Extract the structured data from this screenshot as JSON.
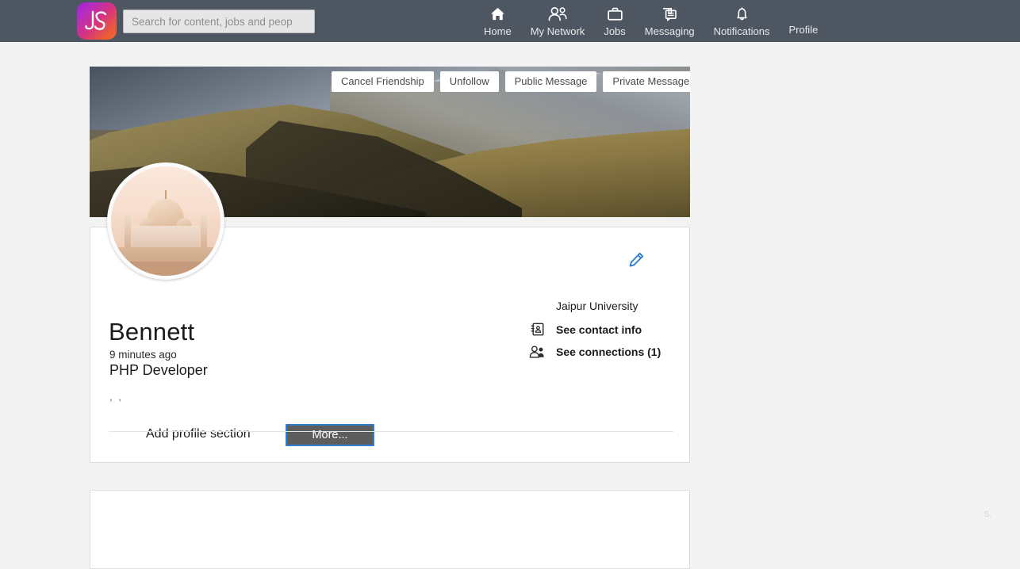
{
  "nav": {
    "logo_text": "JS",
    "search": {
      "placeholder": "Search for content, jobs and peop",
      "value": ""
    },
    "items": [
      {
        "label": "Home",
        "icon": "home-icon"
      },
      {
        "label": "My Network",
        "icon": "people-icon"
      },
      {
        "label": "Jobs",
        "icon": "briefcase-icon"
      },
      {
        "label": "Messaging",
        "icon": "chat-icon"
      },
      {
        "label": "Notifications",
        "icon": "bell-icon"
      },
      {
        "label": "Profile",
        "icon": ""
      }
    ]
  },
  "cover": {
    "actions": [
      {
        "label": "Cancel Friendship"
      },
      {
        "label": "Unfollow"
      },
      {
        "label": "Public Message"
      },
      {
        "label": "Private Message"
      }
    ]
  },
  "profile": {
    "avatar_alt": "avatar-taj-mahal",
    "name": "Bennett",
    "time_ago": "9 minutes ago",
    "headline": "PHP Developer",
    "location": ", ,",
    "university": "Jaipur University",
    "contact_info_label": "See contact info",
    "connections_label": "See connections (1)",
    "add_section_label": "Add profile section",
    "more_label": "More...",
    "edit_icon": "pencil-edit-icon"
  },
  "footer": {
    "corner_mark": "S."
  },
  "colors": {
    "nav_bg": "#4e5761",
    "page_bg": "#f3f3f3",
    "card_bg": "#ffffff",
    "accent_blue": "#2f7fd0",
    "more_btn_bg": "#5d5d5d",
    "text_dark": "#1b1b1b"
  }
}
